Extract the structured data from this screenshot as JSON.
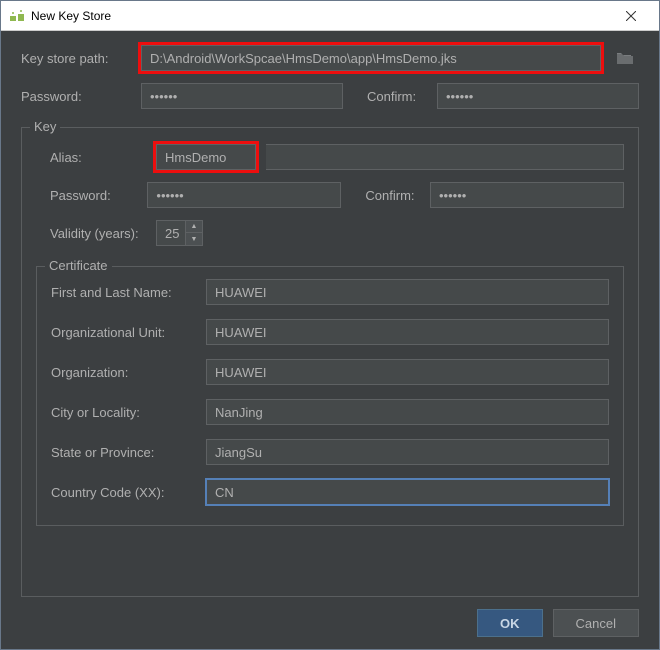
{
  "window": {
    "title": "New Key Store"
  },
  "keystore": {
    "path_label": "Key store path:",
    "path_value": "D:\\Android\\WorkSpcae\\HmsDemo\\app\\HmsDemo.jks",
    "password_label": "Password:",
    "password_value": "••••••",
    "confirm_label": "Confirm:",
    "confirm_value": "••••••"
  },
  "key": {
    "legend": "Key",
    "alias_label": "Alias:",
    "alias_value": "HmsDemo",
    "password_label": "Password:",
    "password_value": "••••••",
    "confirm_label": "Confirm:",
    "confirm_value": "••••••",
    "validity_label": "Validity (years):",
    "validity_value": "25"
  },
  "certificate": {
    "legend": "Certificate",
    "first_last_label": "First and Last Name:",
    "first_last_value": "HUAWEI",
    "org_unit_label": "Organizational Unit:",
    "org_unit_value": "HUAWEI",
    "org_label": "Organization:",
    "org_value": "HUAWEI",
    "city_label": "City or Locality:",
    "city_value": "NanJing",
    "state_label": "State or Province:",
    "state_value": "JiangSu",
    "country_label": "Country Code (XX):",
    "country_value": "CN"
  },
  "buttons": {
    "ok": "OK",
    "cancel": "Cancel"
  }
}
